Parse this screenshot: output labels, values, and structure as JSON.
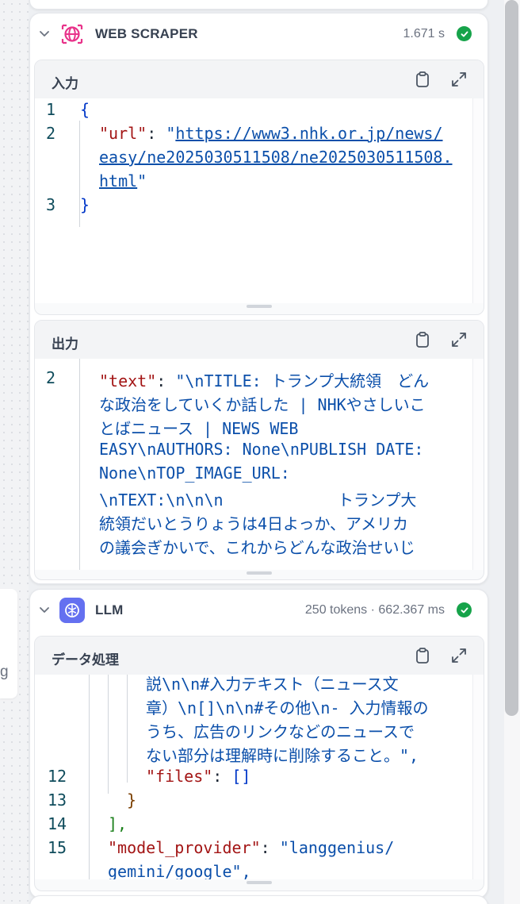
{
  "scraper": {
    "title": "WEB SCRAPER",
    "meta": "1.671 s",
    "input": {
      "label": "入力",
      "lines": [
        {
          "n": "1",
          "brace": "{"
        },
        {
          "n": "2",
          "key": "\"url\"",
          "sep": ": ",
          "q": "\"",
          "url1": "https://www3.nhk.or.jp/news/",
          "url2": "easy/ne2025030511508/ne2025030511508.",
          "url3": "html",
          "qe": "\""
        },
        {
          "n": "3",
          "brace": "}"
        }
      ]
    },
    "output": {
      "label": "出力",
      "line_num": "2",
      "key": "\"text\"",
      "sep": ": ",
      "wrapped": [
        "\"\\nTITLE: トランプ大統領　どん",
        "な政治をしていくか話した | NHKやさしいこ",
        "とばニュース | NEWS WEB",
        "EASY\\nAUTHORS: None\\nPUBLISH DATE:",
        "None\\nTOP_IMAGE_URL:",
        "\\nTEXT:\\n\\n\\n            トランプ大",
        "統領だいとうりょうは4日よっか、アメリカ",
        "の議会ぎかいで、これからどんな政治せいじ"
      ]
    }
  },
  "llm": {
    "title": "LLM",
    "meta": "250 tokens · 662.367 ms",
    "data": {
      "label": "データ処理",
      "text_lines": [
        "説\\n\\n#入力テキスト（ニュース文",
        "章）\\n[]\\n\\n#その他\\n- 入力情報の",
        "うち、広告のリンクなどのニュースで",
        "ない部分は理解時に削除すること。\","
      ],
      "line12": {
        "n": "12",
        "key": "\"files\"",
        "sep": ": ",
        "val": "[]"
      },
      "line13": {
        "n": "13",
        "brace": "}"
      },
      "line14": {
        "n": "14",
        "brace": "],"
      },
      "line15": {
        "n": "15",
        "key": "\"model_provider\"",
        "sep": ": ",
        "val1": "\"langgenius/",
        "val2": "gemini/google\","
      }
    }
  },
  "left_ghost_text": "g",
  "colors": {
    "accent": "#16a34a",
    "scraper_icon": "#e8338a",
    "llm_icon": "#6470f0"
  },
  "icons": [
    "chevron-down-icon",
    "globe-icon",
    "check-circle-icon",
    "clipboard-icon",
    "expand-icon",
    "llm-brain-icon"
  ]
}
